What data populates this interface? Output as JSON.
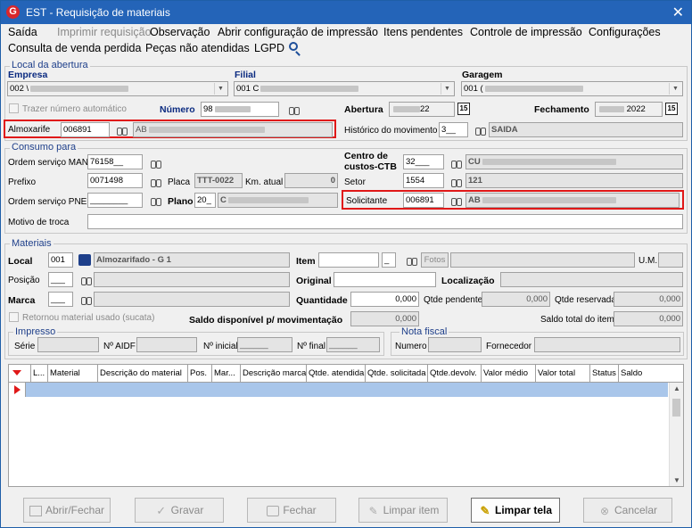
{
  "window": {
    "title": "EST - Requisição de materiais",
    "close_glyph": "✕",
    "logo_glyph": "G"
  },
  "menu": {
    "items": [
      "Saída",
      "Imprimir requisição",
      "Observação",
      "Abrir configuração de impressão",
      "Itens pendentes",
      "Controle de impressão",
      "Configurações",
      "Consulta de venda perdida",
      "Peças não atendidas",
      "LGPD"
    ],
    "disabled": [
      "Imprimir requisição"
    ]
  },
  "local_abertura": {
    "title": "Local da abertura",
    "empresa_label": "Empresa",
    "empresa_value": "002 \\",
    "filial_label": "Filial",
    "filial_value": "001 C",
    "garagem_label": "Garagem",
    "garagem_value": "001 (",
    "trazer_numero_label": "Trazer número automático",
    "numero_label": "Número",
    "numero_value": "98",
    "abertura_label": "Abertura",
    "abertura_value": "22",
    "fechamento_label": "Fechamento",
    "fechamento_value": "2022",
    "cal_glyph": "15",
    "almoxarife_label": "Almoxarife",
    "almoxarife_code": "006891",
    "almoxarife_name": "AB",
    "historico_label": "Histórico do movimento",
    "historico_code": "3__",
    "historico_desc": "SAIDA"
  },
  "consumo_para": {
    "title": "Consumo para",
    "ordem_man_label": "Ordem serviço MAN",
    "ordem_man_value": "76158__",
    "centro_custos_label_1": "Centro de",
    "centro_custos_label_2": "custos-CTB",
    "centro_custos_code": "32___",
    "centro_custos_desc": "CU",
    "prefixo_label": "Prefixo",
    "prefixo_value": "0071498",
    "placa_label": "Placa",
    "placa_value": "TTT-0022",
    "km_label": "Km. atual",
    "km_value": "0",
    "setor_label": "Setor",
    "setor_code": "1554",
    "setor_desc": "121",
    "ordem_pne_label": "Ordem serviço PNE",
    "ordem_pne_value": "________",
    "plano_label": "Plano",
    "plano_code": "20_",
    "plano_desc": "C",
    "solicitante_label": "Solicitante",
    "solicitante_code": "006891",
    "solicitante_name": "AB",
    "motivo_label": "Motivo de troca",
    "motivo_value": ""
  },
  "materiais": {
    "title": "Materiais",
    "local_label": "Local",
    "local_code": "001",
    "local_desc": "Almozarifado - G 1",
    "item_label": "Item",
    "item_value": "",
    "item_suffix": "_",
    "fotos_label": "Fotos",
    "um_label": "U.M.",
    "posicao_label": "Posição",
    "posicao_value": "___",
    "original_label": "Original",
    "localizacao_label": "Localização",
    "marca_label": "Marca",
    "marca_value": "___",
    "quantidade_label": "Quantidade",
    "quantidade_value": "0,000",
    "qtde_pendente_label": "Qtde pendente",
    "qtde_pendente_value": "0,000",
    "qtde_reservada_label": "Qtde reservada",
    "qtde_reservada_value": "0,000",
    "retornou_label": "Retornou material usado (sucata)",
    "saldo_mov_label": "Saldo disponível p/ movimentação",
    "saldo_mov_value": "0,000",
    "saldo_item_label": "Saldo total do item",
    "saldo_item_value": "0,000"
  },
  "impresso": {
    "title": "Impresso",
    "serie_label": "Série",
    "aidf_label": "Nº AIDF",
    "inicial_label": "Nº inicial",
    "inicial_value": "______",
    "final_label": "Nº final",
    "final_value": "______"
  },
  "nota_fiscal": {
    "title": "Nota fiscal",
    "numero_label": "Numero",
    "fornecedor_label": "Fornecedor"
  },
  "grid": {
    "columns": [
      "L...",
      "Material",
      "Descrição do material",
      "Pos.",
      "Mar...",
      "Descrição marca",
      "Qtde. atendida",
      "Qtde. solicitada",
      "Qtde.devolv.",
      "Valor médio",
      "Valor total",
      "Status",
      "Saldo"
    ]
  },
  "buttons": {
    "abrir_fechar": "Abrir/Fechar",
    "gravar": "Gravar",
    "fechar": "Fechar",
    "limpar_item": "Limpar item",
    "limpar_tela": "Limpar tela",
    "cancelar": "Cancelar"
  },
  "colors": {
    "titlebar": "#2464b8",
    "highlight_border": "#e01818",
    "grid_selected_row": "#a9c6ea"
  }
}
